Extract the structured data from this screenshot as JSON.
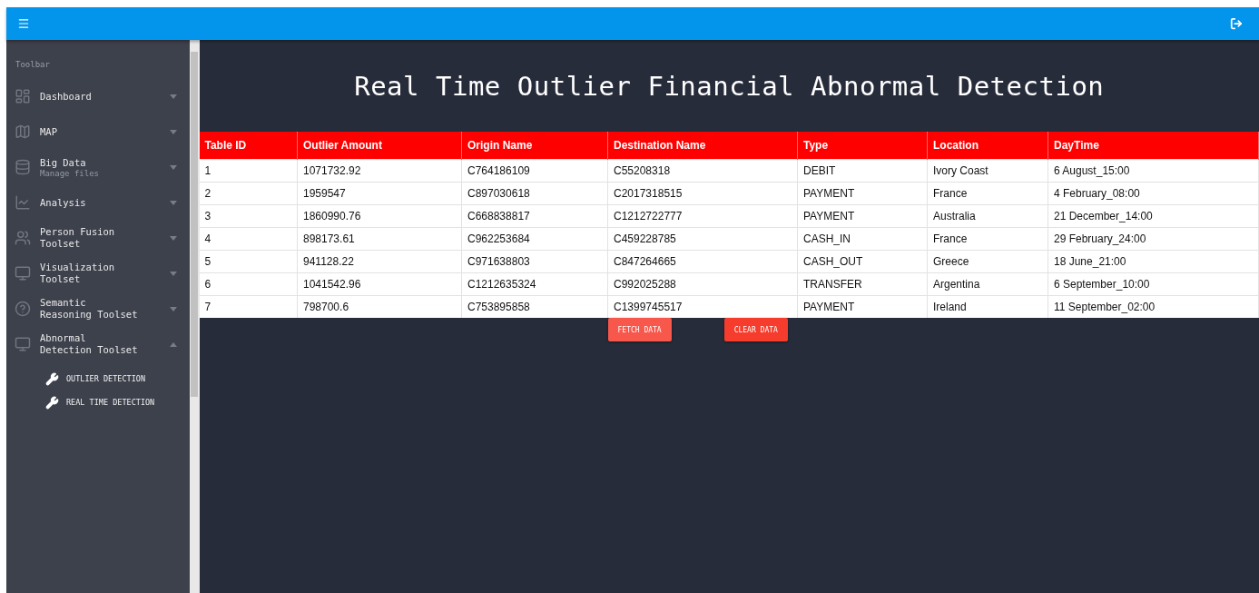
{
  "sidebar": {
    "heading": "Toolbar",
    "items": [
      {
        "kind": "dashboard",
        "label": "Dashboard",
        "expanded": false
      },
      {
        "kind": "map",
        "label": "MAP",
        "expanded": false
      },
      {
        "kind": "database",
        "label": "Big Data",
        "subtitle": "Manage files",
        "expanded": false
      },
      {
        "kind": "chart",
        "label": "Analysis",
        "expanded": false
      },
      {
        "kind": "people",
        "label": "Person Fusion Toolset",
        "expanded": false
      },
      {
        "kind": "monitor",
        "label": "Visualization Toolset",
        "expanded": false
      },
      {
        "kind": "help",
        "label": "Semantic Reasoning Toolset",
        "expanded": false
      },
      {
        "kind": "monitor",
        "label": "Abnormal Detection Toolset",
        "expanded": true,
        "children": [
          {
            "label": "OUTLIER DETECTION"
          },
          {
            "label": "REAL TIME DETECTION"
          }
        ]
      }
    ]
  },
  "main": {
    "title": "Real Time Outlier Financial Abnormal Detection",
    "table": {
      "columns": [
        "Table ID",
        "Outlier Amount",
        "Origin Name",
        "Destination Name",
        "Type",
        "Location",
        "DayTime"
      ],
      "rows": [
        [
          "1",
          "1071732.92",
          "C764186109",
          "C55208318",
          "DEBIT",
          "Ivory Coast",
          "6 August_15:00"
        ],
        [
          "2",
          "1959547",
          "C897030618",
          "C2017318515",
          "PAYMENT",
          "France",
          "4 February_08:00"
        ],
        [
          "3",
          "1860990.76",
          "C668838817",
          "C1212722777",
          "PAYMENT",
          "Australia",
          "21 December_14:00"
        ],
        [
          "4",
          "898173.61",
          "C962253684",
          "C459228785",
          "CASH_IN",
          "France",
          "29 February_24:00"
        ],
        [
          "5",
          "941128.22",
          "C971638803",
          "C847264665",
          "CASH_OUT",
          "Greece",
          "18 June_21:00"
        ],
        [
          "6",
          "1041542.96",
          "C1212635324",
          "C992025288",
          "TRANSFER",
          "Argentina",
          "6 September_10:00"
        ],
        [
          "7",
          "798700.6",
          "C753895858",
          "C1399745517",
          "PAYMENT",
          "Ireland",
          "11 September_02:00"
        ]
      ]
    },
    "buttons": [
      "FETCH DATA",
      "CLEAR DATA"
    ]
  }
}
